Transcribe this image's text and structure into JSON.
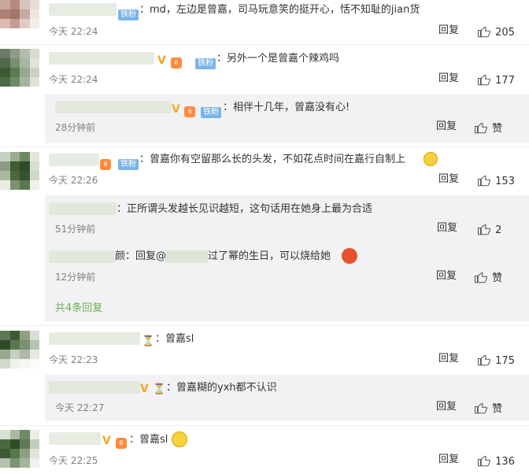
{
  "reply_label": "回复",
  "fan_badge": "铁粉",
  "comments": [
    {
      "text": "：md，左边是曾嘉，司马玩意笑的挺开心，恬不知耻的jian货",
      "time": "今天 22:24",
      "likes": "205"
    },
    {
      "text": "：另外一个是曾嘉个辣鸡吗",
      "time": "今天 22:24",
      "likes": "177",
      "sub": {
        "text": "：相伴十几年，曾嘉没有心!",
        "time": "28分钟前",
        "likes": "赞"
      }
    },
    {
      "text": "：曾嘉你有空留那么长的头发，不如花点时间在嘉行自制上",
      "time": "今天 22:26",
      "likes": "153",
      "subs": [
        {
          "text": "：正所谓头发越长见识越短，这句话用在她身上最为合适",
          "time": "51分钟前",
          "likes": "2"
        },
        {
          "prefix": "颜：回复@",
          "text": "过了幂的生日，可以烧给她",
          "time": "12分钟前",
          "likes": "赞"
        }
      ],
      "more": "共4条回复"
    },
    {
      "text": "：曾嘉sl",
      "time": "今天 22:23",
      "likes": "175",
      "sub": {
        "text": "：曾嘉糊的yxh都不认识",
        "time": "今天 22:27",
        "likes": "赞"
      }
    },
    {
      "text": "：曾嘉sl",
      "time": "今天 22:25",
      "likes": "136"
    }
  ]
}
